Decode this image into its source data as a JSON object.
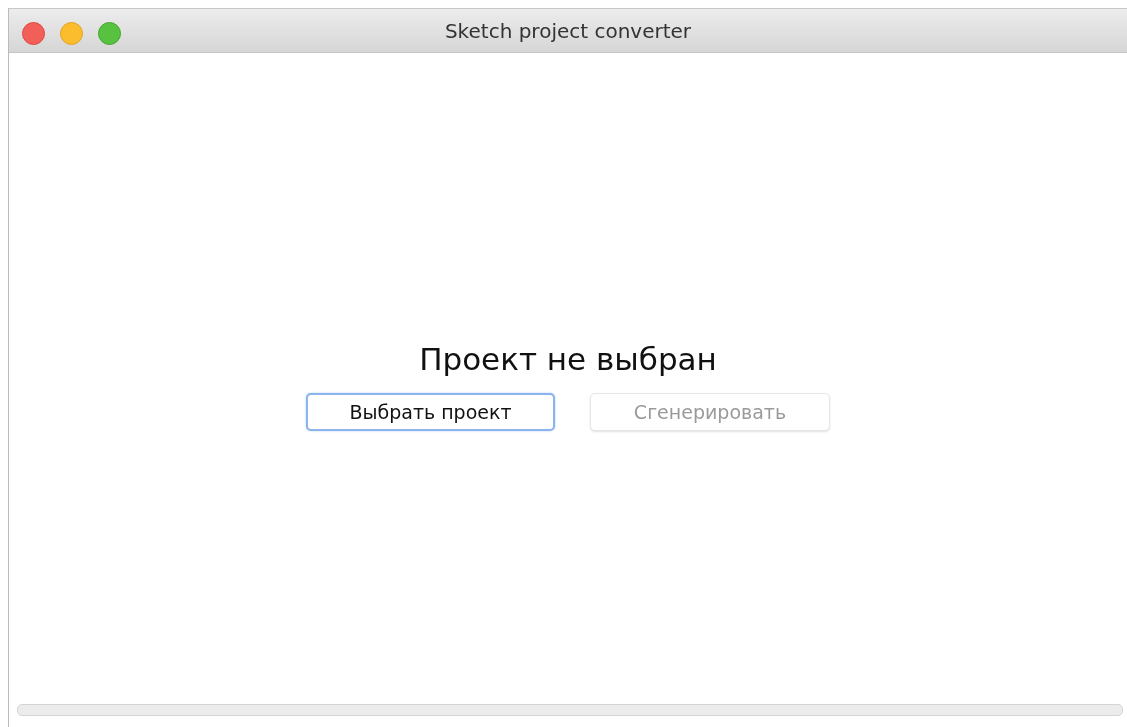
{
  "window": {
    "title": "Sketch project converter"
  },
  "heading": "Проект не выбран",
  "buttons": [
    {
      "label": "Выбрать проект",
      "focused": true,
      "disabled": false
    },
    {
      "label": "Сгенерировать",
      "focused": false,
      "disabled": true
    }
  ],
  "progress": {
    "level": 0
  }
}
